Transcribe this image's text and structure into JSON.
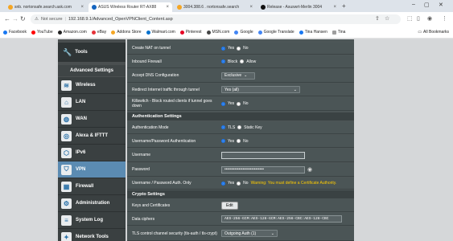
{
  "browser": {
    "tabs": [
      {
        "title": "snb. nortonsafe.search.ask.com",
        "color": "#f5a623",
        "active": false
      },
      {
        "title": "ASUS Wireless Router RT-AX88",
        "color": "#1565c0",
        "active": true
      },
      {
        "title": "3004.388.6 . nortonsafe.search",
        "color": "#f5a623",
        "active": false
      },
      {
        "title": "Release - Asuswrt-Merlin 3004",
        "color": "#111111",
        "active": false
      }
    ],
    "new_tab": "+",
    "address": {
      "security": "Not secure",
      "url": "192.168.9.1/Advanced_OpenVPNClient_Content.asp"
    },
    "bookmarks": [
      {
        "label": "Facebook",
        "color": "#1877f2"
      },
      {
        "label": "YouTube",
        "color": "#ff0000"
      },
      {
        "label": "Amazon.com",
        "color": "#222222"
      },
      {
        "label": "eBay",
        "color": "#e53238"
      },
      {
        "label": "Addons Store",
        "color": "#f5a623"
      },
      {
        "label": "Walmart.com",
        "color": "#0071ce"
      },
      {
        "label": "Pinterest",
        "color": "#e60023"
      },
      {
        "label": "MSN.com",
        "color": "#444444"
      },
      {
        "label": "Google",
        "color": "#4285f4"
      },
      {
        "label": "Google Translate",
        "color": "#4285f4"
      },
      {
        "label": "Tina Hansen",
        "color": "#1877f2"
      },
      {
        "label": "Tina",
        "color": "#9e9e9e"
      }
    ],
    "all_bookmarks": "All Bookmarks"
  },
  "sidebar": {
    "top_item": "Tools",
    "section_header": "Advanced Settings",
    "items": [
      {
        "label": "Wireless",
        "icon": "wifi-icon",
        "glyph": "≋",
        "selected": false
      },
      {
        "label": "LAN",
        "icon": "lan-icon",
        "glyph": "⌂",
        "selected": false
      },
      {
        "label": "WAN",
        "icon": "globe-icon",
        "glyph": "◍",
        "selected": false
      },
      {
        "label": "Alexa & IFTTT",
        "icon": "alexa-icon",
        "glyph": "◎",
        "selected": false
      },
      {
        "label": "IPv6",
        "icon": "ipv6-icon",
        "glyph": "⬡",
        "selected": false
      },
      {
        "label": "VPN",
        "icon": "vpn-icon",
        "glyph": "⛉",
        "selected": true
      },
      {
        "label": "Firewall",
        "icon": "firewall-icon",
        "glyph": "▦",
        "selected": false
      },
      {
        "label": "Administration",
        "icon": "admin-icon",
        "glyph": "⚙",
        "selected": false
      },
      {
        "label": "System Log",
        "icon": "log-icon",
        "glyph": "≡",
        "selected": false
      },
      {
        "label": "Network Tools",
        "icon": "tools-icon",
        "glyph": "✦",
        "selected": false
      }
    ]
  },
  "form": {
    "create_nat": {
      "label": "Create NAT on tunnel",
      "yes": "Yes",
      "no": "No"
    },
    "inbound_firewall": {
      "label": "Inbound Firewall",
      "block": "Block",
      "allow": "Allow"
    },
    "accept_dns": {
      "label": "Accept DNS Configuration",
      "value": "Exclusive"
    },
    "redirect": {
      "label": "Redirect Internet traffic through tunnel",
      "value": "Yes (all)"
    },
    "killswitch": {
      "label": "Killswitch - Block routed clients if tunnel goes down",
      "yes": "Yes",
      "no": "No"
    },
    "auth_section": "Authentication Settings",
    "auth_mode": {
      "label": "Authentication Mode",
      "tls": "TLS",
      "static": "Static Key"
    },
    "userpass_auth": {
      "label": "Username/Password Authentication",
      "yes": "Yes",
      "no": "No"
    },
    "username": {
      "label": "Username",
      "value": ""
    },
    "password": {
      "label": "Password",
      "value": "••••••••••••••••••••••••••••"
    },
    "userpass_only": {
      "label": "Username / Password Auth. Only",
      "yes": "Yes",
      "no": "No",
      "warning": "Warning: You must define a Certificate Authority."
    },
    "crypto_section": "Crypto Settings",
    "keys": {
      "label": "Keys and Certificates",
      "button": "Edit"
    },
    "ciphers": {
      "label": "Data ciphers",
      "value": "AES-256-GCM:AES-128-GCM:AES-256-CBC:AES-128-CBC"
    },
    "tls_control": {
      "label": "TLS control channel security (tls-auth / tls-crypt)",
      "value": "Outgoing Auth (1)"
    }
  }
}
